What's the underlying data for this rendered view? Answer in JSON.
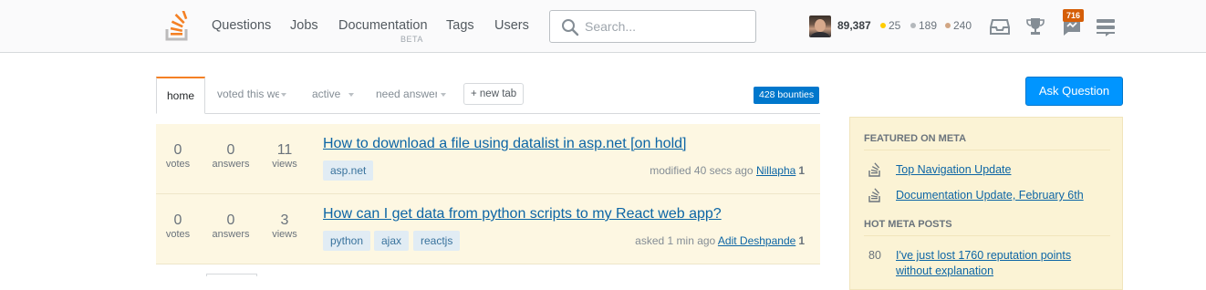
{
  "nav": {
    "items": [
      {
        "label": "Questions"
      },
      {
        "label": "Jobs"
      },
      {
        "label": "Documentation"
      },
      {
        "label": "Tags"
      },
      {
        "label": "Users"
      }
    ],
    "documentation_badge": "BETA"
  },
  "search": {
    "placeholder": "Search...",
    "icon": "search-icon"
  },
  "user": {
    "reputation": "89,387",
    "gold": "25",
    "silver": "189",
    "bronze": "240",
    "colors": {
      "gold": "#ffcc01",
      "silver": "#b4b8bc",
      "bronze": "#d1a684"
    }
  },
  "topbar_icons": [
    "inbox-icon",
    "trophy-icon",
    "review-icon",
    "site-switcher-icon"
  ],
  "review_count": "716",
  "tabs": {
    "items": [
      {
        "label": "home",
        "active": true
      },
      {
        "label": "voted this week"
      },
      {
        "label": "active"
      },
      {
        "label": "need answers"
      }
    ],
    "new_tab": "+ new tab",
    "bounties": "428 bounties"
  },
  "questions": [
    {
      "votes": "0",
      "votes_label": "votes",
      "answers": "0",
      "answers_label": "answers",
      "views": "11",
      "views_label": "views",
      "title": "How to download a file using datalist in asp.net [on hold]",
      "tags": [
        "asp.net"
      ],
      "action": "modified 40 secs ago",
      "user": "Nillapha",
      "user_rep": "1"
    },
    {
      "votes": "0",
      "votes_label": "votes",
      "answers": "0",
      "answers_label": "answers",
      "views": "3",
      "views_label": "views",
      "title": "How can I get data from python scripts to my React web app?",
      "tags": [
        "python",
        "ajax",
        "reactjs"
      ],
      "action": "asked 1 min ago",
      "user": "Adit Deshpande",
      "user_rep": "1"
    }
  ],
  "sidebar": {
    "ask_button": "Ask Question",
    "featured_heading": "FEATURED ON META",
    "featured": [
      {
        "label": "Top Navigation Update"
      },
      {
        "label": "Documentation Update, February 6th"
      }
    ],
    "hot_heading": "HOT META POSTS",
    "hot": [
      {
        "score": "80",
        "label": "I've just lost 1760 reputation points without explanation"
      }
    ]
  },
  "colors": {
    "accent": "#f48024",
    "link": "#0c65a5",
    "button": "#0095ff",
    "tag_bg": "#e1ecf4",
    "question_bg": "#fdf7e2"
  }
}
